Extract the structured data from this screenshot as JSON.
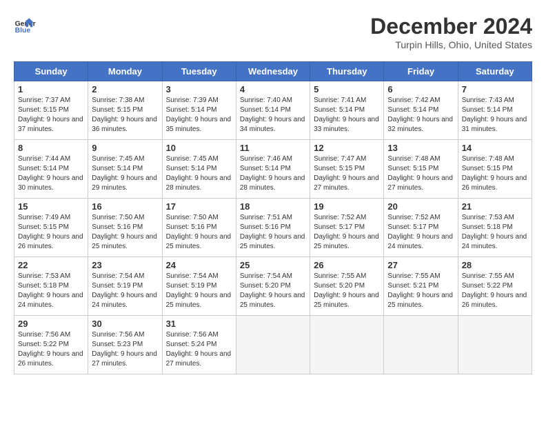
{
  "header": {
    "logo_line1": "General",
    "logo_line2": "Blue",
    "title": "December 2024",
    "subtitle": "Turpin Hills, Ohio, United States"
  },
  "calendar": {
    "days_of_week": [
      "Sunday",
      "Monday",
      "Tuesday",
      "Wednesday",
      "Thursday",
      "Friday",
      "Saturday"
    ],
    "weeks": [
      [
        {
          "day": "1",
          "sunrise": "7:37 AM",
          "sunset": "5:15 PM",
          "daylight": "9 hours and 37 minutes"
        },
        {
          "day": "2",
          "sunrise": "7:38 AM",
          "sunset": "5:15 PM",
          "daylight": "9 hours and 36 minutes"
        },
        {
          "day": "3",
          "sunrise": "7:39 AM",
          "sunset": "5:14 PM",
          "daylight": "9 hours and 35 minutes"
        },
        {
          "day": "4",
          "sunrise": "7:40 AM",
          "sunset": "5:14 PM",
          "daylight": "9 hours and 34 minutes"
        },
        {
          "day": "5",
          "sunrise": "7:41 AM",
          "sunset": "5:14 PM",
          "daylight": "9 hours and 33 minutes"
        },
        {
          "day": "6",
          "sunrise": "7:42 AM",
          "sunset": "5:14 PM",
          "daylight": "9 hours and 32 minutes"
        },
        {
          "day": "7",
          "sunrise": "7:43 AM",
          "sunset": "5:14 PM",
          "daylight": "9 hours and 31 minutes"
        }
      ],
      [
        {
          "day": "8",
          "sunrise": "7:44 AM",
          "sunset": "5:14 PM",
          "daylight": "9 hours and 30 minutes"
        },
        {
          "day": "9",
          "sunrise": "7:45 AM",
          "sunset": "5:14 PM",
          "daylight": "9 hours and 29 minutes"
        },
        {
          "day": "10",
          "sunrise": "7:45 AM",
          "sunset": "5:14 PM",
          "daylight": "9 hours and 28 minutes"
        },
        {
          "day": "11",
          "sunrise": "7:46 AM",
          "sunset": "5:14 PM",
          "daylight": "9 hours and 28 minutes"
        },
        {
          "day": "12",
          "sunrise": "7:47 AM",
          "sunset": "5:15 PM",
          "daylight": "9 hours and 27 minutes"
        },
        {
          "day": "13",
          "sunrise": "7:48 AM",
          "sunset": "5:15 PM",
          "daylight": "9 hours and 27 minutes"
        },
        {
          "day": "14",
          "sunrise": "7:48 AM",
          "sunset": "5:15 PM",
          "daylight": "9 hours and 26 minutes"
        }
      ],
      [
        {
          "day": "15",
          "sunrise": "7:49 AM",
          "sunset": "5:15 PM",
          "daylight": "9 hours and 26 minutes"
        },
        {
          "day": "16",
          "sunrise": "7:50 AM",
          "sunset": "5:16 PM",
          "daylight": "9 hours and 25 minutes"
        },
        {
          "day": "17",
          "sunrise": "7:50 AM",
          "sunset": "5:16 PM",
          "daylight": "9 hours and 25 minutes"
        },
        {
          "day": "18",
          "sunrise": "7:51 AM",
          "sunset": "5:16 PM",
          "daylight": "9 hours and 25 minutes"
        },
        {
          "day": "19",
          "sunrise": "7:52 AM",
          "sunset": "5:17 PM",
          "daylight": "9 hours and 25 minutes"
        },
        {
          "day": "20",
          "sunrise": "7:52 AM",
          "sunset": "5:17 PM",
          "daylight": "9 hours and 24 minutes"
        },
        {
          "day": "21",
          "sunrise": "7:53 AM",
          "sunset": "5:18 PM",
          "daylight": "9 hours and 24 minutes"
        }
      ],
      [
        {
          "day": "22",
          "sunrise": "7:53 AM",
          "sunset": "5:18 PM",
          "daylight": "9 hours and 24 minutes"
        },
        {
          "day": "23",
          "sunrise": "7:54 AM",
          "sunset": "5:19 PM",
          "daylight": "9 hours and 24 minutes"
        },
        {
          "day": "24",
          "sunrise": "7:54 AM",
          "sunset": "5:19 PM",
          "daylight": "9 hours and 25 minutes"
        },
        {
          "day": "25",
          "sunrise": "7:54 AM",
          "sunset": "5:20 PM",
          "daylight": "9 hours and 25 minutes"
        },
        {
          "day": "26",
          "sunrise": "7:55 AM",
          "sunset": "5:20 PM",
          "daylight": "9 hours and 25 minutes"
        },
        {
          "day": "27",
          "sunrise": "7:55 AM",
          "sunset": "5:21 PM",
          "daylight": "9 hours and 25 minutes"
        },
        {
          "day": "28",
          "sunrise": "7:55 AM",
          "sunset": "5:22 PM",
          "daylight": "9 hours and 26 minutes"
        }
      ],
      [
        {
          "day": "29",
          "sunrise": "7:56 AM",
          "sunset": "5:22 PM",
          "daylight": "9 hours and 26 minutes"
        },
        {
          "day": "30",
          "sunrise": "7:56 AM",
          "sunset": "5:23 PM",
          "daylight": "9 hours and 27 minutes"
        },
        {
          "day": "31",
          "sunrise": "7:56 AM",
          "sunset": "5:24 PM",
          "daylight": "9 hours and 27 minutes"
        },
        null,
        null,
        null,
        null
      ]
    ]
  }
}
